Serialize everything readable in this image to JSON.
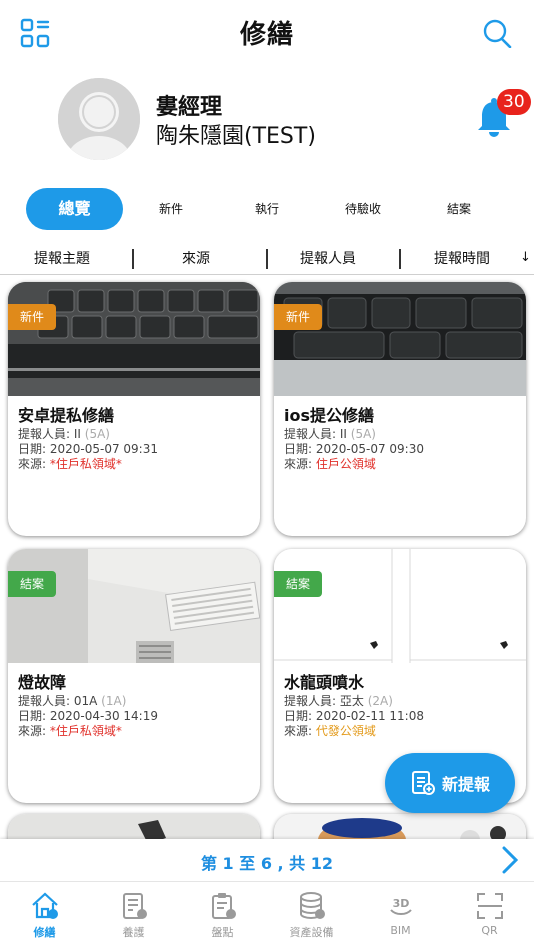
{
  "header": {
    "title": "修繕",
    "menu_icon": "grid-menu-icon",
    "search_icon": "search-icon"
  },
  "profile": {
    "name": "婁經理",
    "org": "陶朱隱園(TEST)",
    "notifications": "30"
  },
  "tabs": [
    {
      "label": "總覽",
      "active": true
    },
    {
      "label": "新件"
    },
    {
      "label": "執行"
    },
    {
      "label": "待驗收"
    },
    {
      "label": "結案"
    }
  ],
  "sort": {
    "columns": [
      "提報主題",
      "來源",
      "提報人員",
      "提報時間"
    ],
    "direction_icon": "↓"
  },
  "cards": [
    {
      "status": "新件",
      "title": "安卓提私修繕",
      "reporter_label": "提報人員: ",
      "reporter": "II",
      "unit": "(5A)",
      "date_label": "日期: ",
      "date": "2020-05-07 09:31",
      "source_label": "來源: ",
      "source": "*住戶私領域*"
    },
    {
      "status": "新件",
      "title": "ios提公修繕",
      "reporter_label": "提報人員: ",
      "reporter": "II",
      "unit": "(5A)",
      "date_label": "日期: ",
      "date": "2020-05-07 09:30",
      "source_label": "來源: ",
      "source": "住戶公領域"
    },
    {
      "status": "結案",
      "title": "燈故障",
      "reporter_label": "提報人員: ",
      "reporter": "01A",
      "unit": "(1A)",
      "date_label": "日期: ",
      "date": "2020-04-30 14:19",
      "source_label": "來源: ",
      "source": "*住戶私領域*"
    },
    {
      "status": "結案",
      "title": "水龍頭噴水",
      "reporter_label": "提報人員: ",
      "reporter": "亞太",
      "unit": "(2A)",
      "date_label": "日期: ",
      "date": "2020-02-11 11:08",
      "source_label": "來源: ",
      "source": "代發公領域"
    }
  ],
  "fab": {
    "label": "新提報"
  },
  "pager": {
    "label": "第 1 至 6 , 共 12"
  },
  "bottom_nav": [
    {
      "label": "修繕",
      "icon": "repair-house-icon",
      "active": true
    },
    {
      "label": "養護",
      "icon": "maintenance-doc-icon"
    },
    {
      "label": "盤點",
      "icon": "inventory-clipboard-icon"
    },
    {
      "label": "資產設備",
      "icon": "asset-database-icon"
    },
    {
      "label": "BIM",
      "icon": "bim-3d-icon"
    },
    {
      "label": "QR",
      "icon": "qr-scan-icon"
    }
  ],
  "colors": {
    "accent": "#1e9ae8",
    "status_new": "#e08a1a",
    "status_closed": "#43a84a",
    "badge": "#e8231c",
    "private_source": "#e0302a",
    "public_source_agent": "#e39a1a"
  }
}
